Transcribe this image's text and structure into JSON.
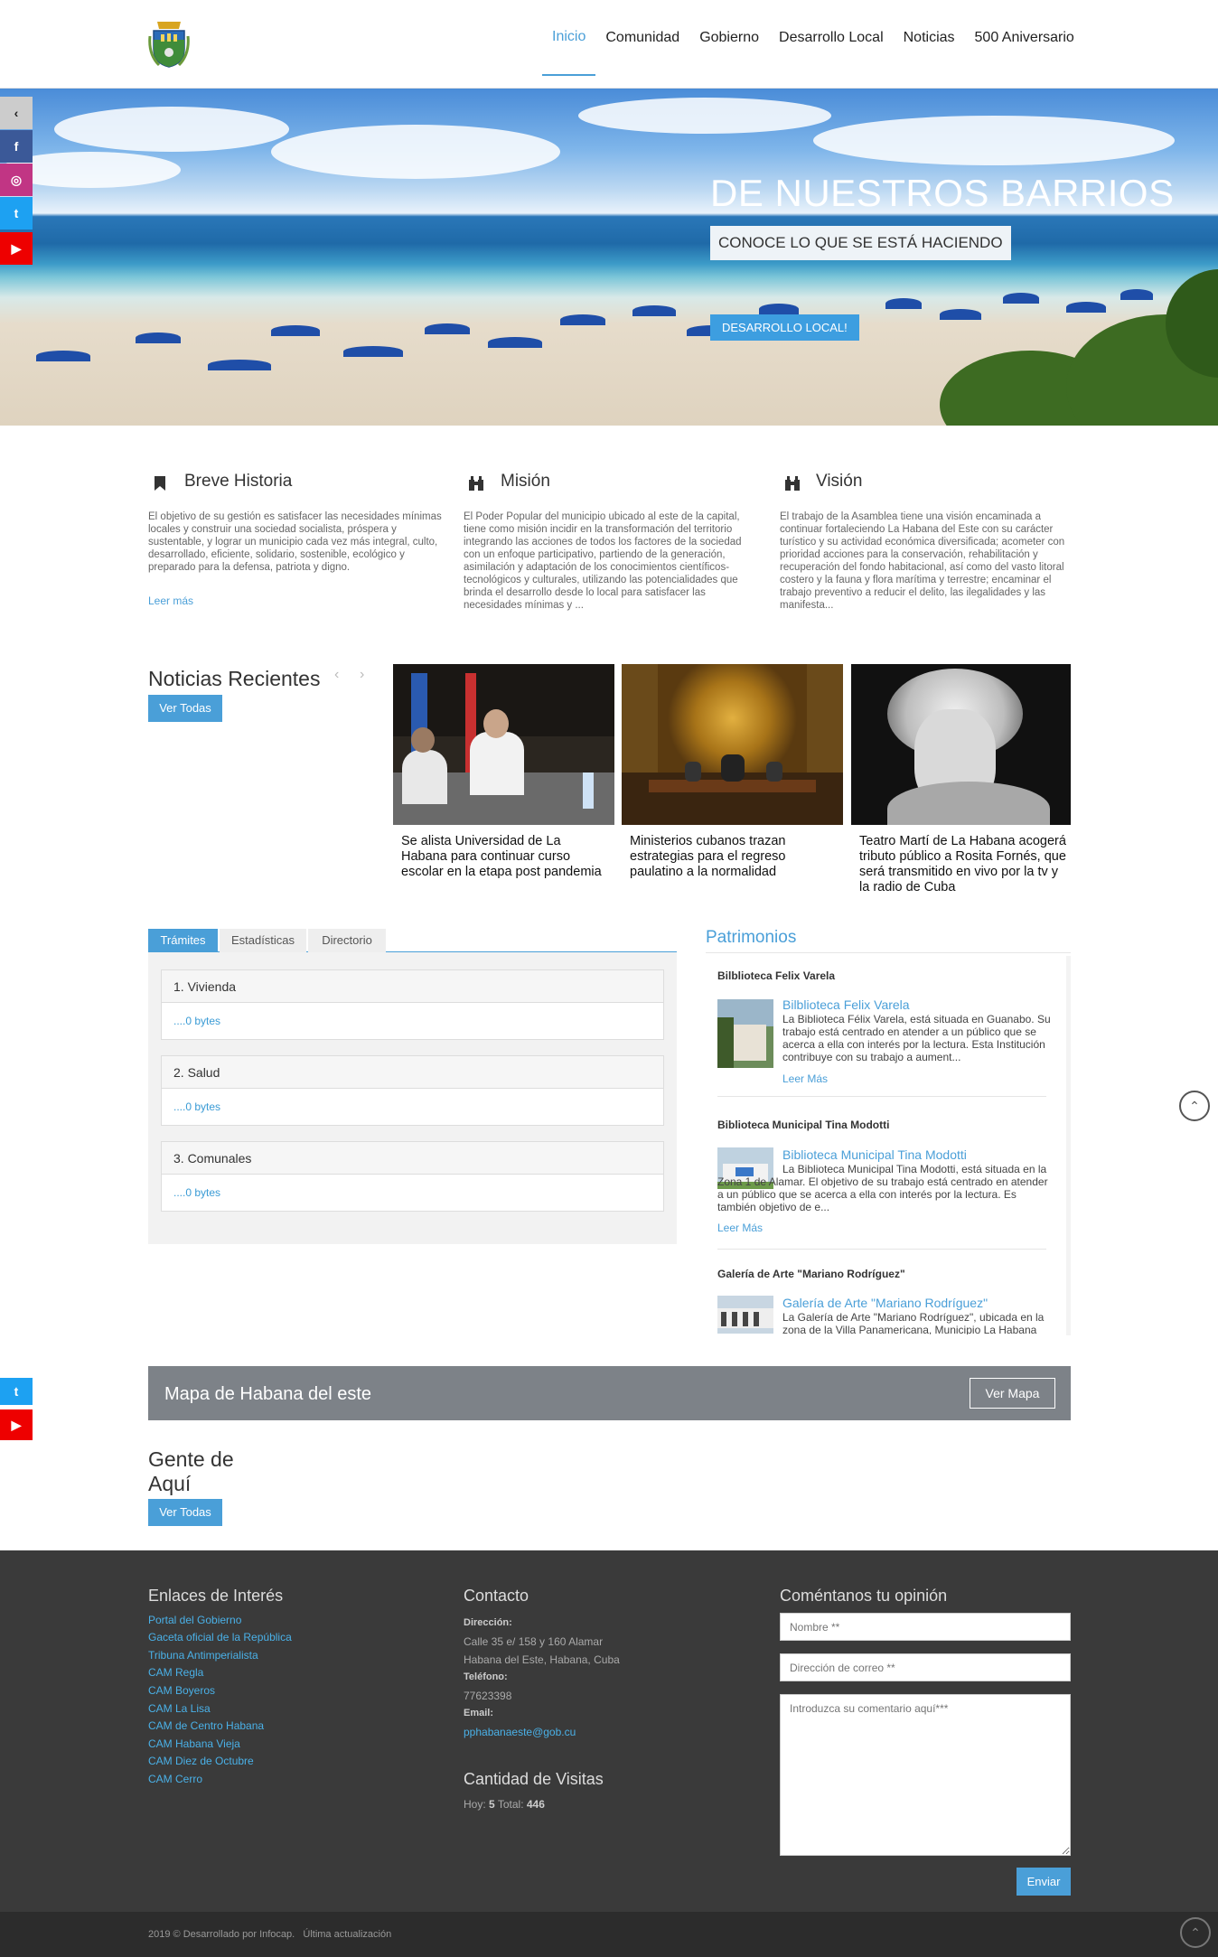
{
  "nav": {
    "items": [
      "Inicio",
      "Comunidad",
      "Gobierno",
      "Desarrollo Local",
      "Noticias",
      "500 Aniversario"
    ],
    "active": "Inicio"
  },
  "hero": {
    "title": "DE NUESTROS BARRIOS",
    "subtitle": "CONOCE LO QUE SE ESTÁ HACIENDO",
    "button": "DESARROLLO LOCAL!"
  },
  "sections": [
    {
      "title": "Breve Historia",
      "icon": "bookmark-icon",
      "text": "El objetivo de su gestión es satisfacer las necesidades mínimas locales y construir una sociedad socialista, próspera y sustentable, y lograr un municipio cada vez más integral, culto, desarrollado, eficiente, solidario, sostenible, ecológico y preparado para la defensa, patriota y digno.",
      "link": "Leer más"
    },
    {
      "title": "Misión",
      "icon": "binoculars-icon",
      "text": "El Poder Popular del municipio ubicado al este de la capital, tiene como misión incidir en la transformación del territorio integrando las acciones de todos los factores de la sociedad con un enfoque participativo, partiendo de la generación, asimilación y adaptación de los conocimientos científicos-tecnológicos y culturales, utilizando las potencialidades que brinda el desarrollo desde lo local para satisfacer las necesidades mínimas y ..."
    },
    {
      "title": "Visión",
      "icon": "binoculars-icon",
      "text": "El trabajo de la Asamblea tiene una visión encaminada a continuar fortaleciendo La Habana del Este con su carácter turístico y su actividad económica diversificada; acometer con prioridad acciones para la conservación, rehabilitación y recuperación del fondo habitacional, así como del vasto litoral costero y la fauna y flora marítima y terrestre; encaminar el trabajo preventivo a reducir el delito, las ilegalidades y las manifesta..."
    }
  ],
  "news": {
    "title": "Noticias Recientes",
    "button": "Ver Todas",
    "items": [
      {
        "caption": "Se alista Universidad de La Habana para continuar curso escolar en la etapa post pandemia"
      },
      {
        "caption": "Ministerios cubanos trazan estrategias para el regreso paulatino a la normalidad"
      },
      {
        "caption": "Teatro Martí de La Habana acogerá tributo público a Rosita Fornés, que será transmitido en vivo por la tv y la radio de Cuba"
      }
    ]
  },
  "tabs": {
    "items": [
      "Trámites",
      "Estadísticas",
      "Directorio"
    ],
    "active": "Trámites",
    "accordion": [
      {
        "title": "1. Vivienda",
        "body": "....0 bytes"
      },
      {
        "title": "2. Salud",
        "body": "....0 bytes"
      },
      {
        "title": "3. Comunales",
        "body": "....0 bytes"
      }
    ]
  },
  "patrimonios": {
    "title": "Patrimonios",
    "items": [
      {
        "heading": "Bilblioteca Felix Varela",
        "link": "Bilblioteca Felix Varela",
        "text": "La Biblioteca Félix Varela, está situada en Guanabo. Su trabajo está centrado en atender a un público que se acerca a ella con interés por la lectura. Esta Institución contribuye con su trabajo a aument...",
        "more": "Leer Más"
      },
      {
        "heading": "Biblioteca Municipal Tina Modotti",
        "link": "Biblioteca Municipal Tina Modotti",
        "text": "La Biblioteca Municipal Tina Modotti, está situada en la Zona 1 de Alamar. El objetivo de su trabajo está centrado en atender a un público que se acerca a ella con interés por la lectura. Es también objetivo de e...",
        "more": "Leer Más"
      },
      {
        "heading": "Galería de Arte \"Mariano Rodríguez\"",
        "link": "Galería de Arte \"Mariano Rodríguez\"",
        "text": "La Galería de Arte \"Mariano Rodríguez\", ubicada en la zona de la Villa Panamericana, Municipio La Habana"
      }
    ]
  },
  "map_banner": {
    "title": "Mapa de Habana del este",
    "button": "Ver Mapa"
  },
  "gente": {
    "title_line1": "Gente de",
    "title_line2": "Aquí",
    "button": "Ver Todas"
  },
  "footer": {
    "links_title": "Enlaces de Interés",
    "links": [
      "Portal del Gobierno",
      "Gaceta oficial de la República",
      "Tribuna Antimperialista",
      "CAM Regla",
      "CAM Boyeros",
      "CAM La Lisa",
      "CAM de Centro Habana",
      "CAM Habana Vieja",
      "CAM Diez de Octubre",
      "CAM Cerro"
    ],
    "contact_title": "Contacto",
    "address_label": "Dirección:",
    "address_line1": "Calle 35 e/ 158 y 160 Alamar",
    "address_line2": "Habana del Este, Habana, Cuba",
    "phone_label": "Teléfono:",
    "phone": "77623398",
    "email_label": "Email:",
    "email": "pphabanaeste@gob.cu",
    "visits_title": "Cantidad de Visitas",
    "visits_today_label": "Hoy:",
    "visits_today": "5",
    "visits_total_label": "Total:",
    "visits_total": "446",
    "comment_title": "Coméntanos tu opinión",
    "name_placeholder": "Nombre **",
    "email_placeholder": "Dirección de correo **",
    "comment_placeholder": "Introduzca su comentario aquí***",
    "send": "Enviar",
    "copyright": "2019 © Desarrollado por Infocap.   Última actualización"
  },
  "colors": {
    "accent": "#4a9fd8",
    "footer_bg": "#3a3a3a",
    "map_banner_bg": "#7d8288"
  }
}
